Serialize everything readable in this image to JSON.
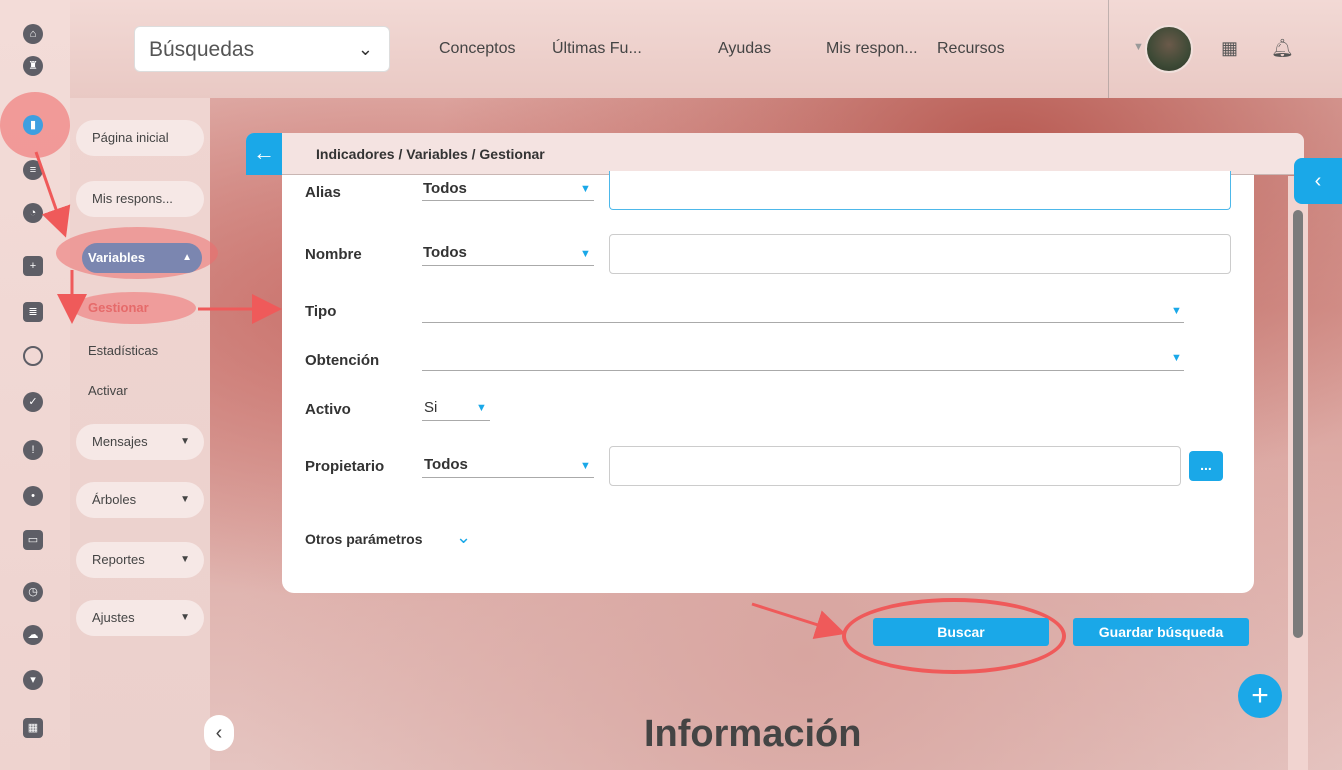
{
  "topbar": {
    "search_select": "Búsquedas",
    "nav": [
      "Conceptos",
      "Últimas Fu...",
      "Ayudas",
      "Mis respon...",
      "Recursos"
    ]
  },
  "menu": {
    "pagina_inicial": "Página inicial",
    "mis_respons": "Mis respons...",
    "variables": "Variables",
    "gestionar": "Gestionar",
    "estadisticas": "Estadísticas",
    "activar": "Activar",
    "mensajes": "Mensajes",
    "arboles": "Árboles",
    "reportes": "Reportes",
    "ajustes": "Ajustes"
  },
  "header": {
    "breadcrumb": "Indicadores / Variables / Gestionar"
  },
  "form": {
    "alias_label": "Alias",
    "alias_mode": "Todos",
    "nombre_label": "Nombre",
    "nombre_mode": "Todos",
    "tipo_label": "Tipo",
    "obtencion_label": "Obtención",
    "activo_label": "Activo",
    "activo_value": "Si",
    "propietario_label": "Propietario",
    "propietario_mode": "Todos",
    "dots": "...",
    "otros": "Otros parámetros"
  },
  "actions": {
    "buscar": "Buscar",
    "guardar": "Guardar búsqueda"
  },
  "info_heading": "Información",
  "colors": {
    "accent": "#1aa8e8",
    "annotation": "#ef5a5a",
    "menu_active": "#7b86b0"
  }
}
